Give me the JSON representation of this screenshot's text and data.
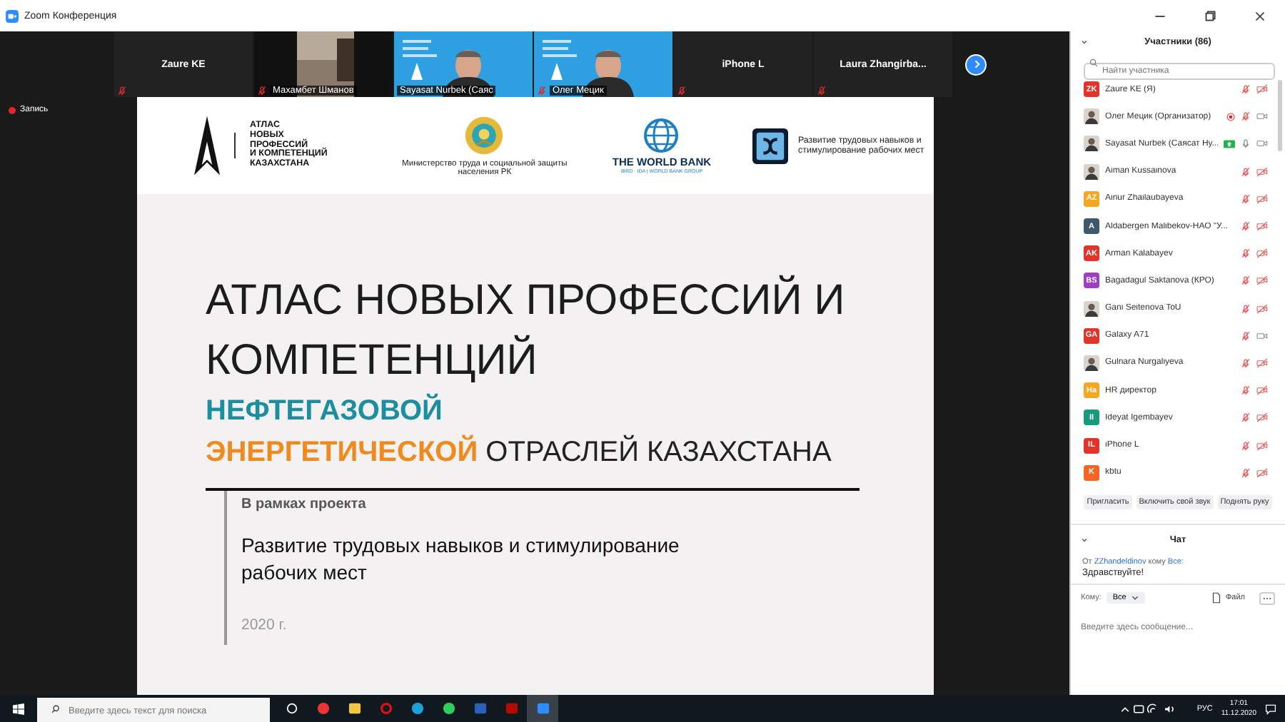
{
  "window": {
    "title": "Zoom Конференция"
  },
  "video_strip": {
    "tiles": [
      {
        "kind": "name",
        "name": "Zaure KE",
        "muted": true
      },
      {
        "kind": "video",
        "name": "Махамбет Шманов",
        "muted": true
      },
      {
        "kind": "video",
        "name": "Sayasat Nurbek (Саяс",
        "muted": false
      },
      {
        "kind": "video",
        "name": "Олег Мецик",
        "muted": true
      },
      {
        "kind": "name",
        "name": "iPhone L",
        "muted": true
      },
      {
        "kind": "name",
        "name": "Laura  Zhangirba...",
        "muted": true
      }
    ]
  },
  "recording": {
    "label": "Запись"
  },
  "slide": {
    "atlas_logo": [
      "АТЛАС",
      "НОВЫХ",
      "ПРОФЕССИЙ",
      "И КОМПЕТЕНЦИЙ",
      "КАЗАХСТАНА"
    ],
    "ministry": "Министерство труда и социальной защиты населения РК",
    "world_bank": "THE WORLD BANK",
    "world_bank_sub": "IBRD · IDA | WORLD BANK GROUP",
    "project_logo": "Развитие трудовых навыков и стимулирование рабочих мест",
    "title": "АТЛАС НОВЫХ ПРОФЕССИЙ И КОМПЕТЕНЦИЙ",
    "subtitle": [
      [
        {
          "text": "НЕФТЕГАЗОВОЙ",
          "color": "#1b8fa0",
          "bold": true
        }
      ],
      [
        {
          "text": "ЭНЕРГЕТИЧЕСКОЙ",
          "color": "#f08a1c",
          "bold": true
        },
        {
          "text": " ОТРАСЛЕЙ КАЗАХСТАНА",
          "color": "#222222",
          "bold": false
        }
      ]
    ],
    "project_label": "В рамках проекта",
    "project": "Развитие трудовых навыков и стимулирование рабочих мест",
    "year": "2020 г."
  },
  "participants": {
    "title": "Участники (86)",
    "search": {
      "placeholder": "Найти участника"
    },
    "items": [
      {
        "name": "Zaure KE (Я)",
        "avatar": {
          "kind": "initials",
          "initials": "ZK",
          "color": "#e0352b"
        },
        "recording": false,
        "sharing": false,
        "muted": true,
        "video_off": true
      },
      {
        "name": "Олег Мецик (Организатор)",
        "recording": true,
        "sharing": false,
        "muted": true,
        "video_off": false
      },
      {
        "name": "Sayasat Nurbek (Саясат Ну...",
        "recording": false,
        "sharing": true,
        "muted": false,
        "video_off": false
      },
      {
        "name": "Aiman Kussainova",
        "recording": false,
        "sharing": false,
        "muted": true,
        "video_off": true
      },
      {
        "name": "Ainur Zhailaubayeva",
        "avatar": {
          "kind": "initials",
          "initials": "AZ",
          "color": "#f5a623"
        },
        "recording": false,
        "sharing": false,
        "muted": true,
        "video_off": true
      },
      {
        "name": "Aldabergen Malibekov-НАО \"У...",
        "avatar": {
          "kind": "initials",
          "initials": "A",
          "color": "#3d5a6c"
        },
        "recording": false,
        "sharing": false,
        "muted": true,
        "video_off": true
      },
      {
        "name": "Arman Kalabayev",
        "avatar": {
          "kind": "initials",
          "initials": "AK",
          "color": "#e0352b"
        },
        "recording": false,
        "sharing": false,
        "muted": true,
        "video_off": true
      },
      {
        "name": "Bagadagul Saktanova (КРО)",
        "avatar": {
          "kind": "initials",
          "initials": "BS",
          "color": "#9c3fc1"
        },
        "recording": false,
        "sharing": false,
        "muted": true,
        "video_off": true
      },
      {
        "name": "Gani Seitenova ToU",
        "recording": false,
        "sharing": false,
        "muted": true,
        "video_off": true
      },
      {
        "name": "Galaxy A71",
        "avatar": {
          "kind": "initials",
          "initials": "GA",
          "color": "#e0352b"
        },
        "recording": false,
        "sharing": false,
        "muted": true,
        "video_off": false
      },
      {
        "name": "Gulnara Nurgaliyeva",
        "recording": false,
        "sharing": false,
        "muted": true,
        "video_off": true
      },
      {
        "name": "HR директор",
        "avatar": {
          "kind": "initials",
          "initials": "Ha",
          "color": "#f5a623"
        },
        "recording": false,
        "sharing": false,
        "muted": true,
        "video_off": true
      },
      {
        "name": "Ideyat Igembayev",
        "avatar": {
          "kind": "initials",
          "initials": "II",
          "color": "#1a9a7c"
        },
        "recording": false,
        "sharing": false,
        "muted": true,
        "video_off": true
      },
      {
        "name": "iPhone L",
        "avatar": {
          "kind": "initials",
          "initials": "IL",
          "color": "#e0352b"
        },
        "recording": false,
        "sharing": false,
        "muted": true,
        "video_off": true
      },
      {
        "name": "kbtu",
        "avatar": {
          "kind": "initials",
          "initials": "K",
          "color": "#f26522"
        },
        "recording": false,
        "sharing": false,
        "muted": true,
        "video_off": true
      }
    ],
    "buttons": [
      "Пригласить",
      "Включить свой звук",
      "Поднять руку"
    ]
  },
  "chat": {
    "title": "Чат",
    "messages": [
      {
        "from_label": "От",
        "from": "ZZhandeldinov",
        "to_label": "кому",
        "to": "Все:",
        "text": "Здравствуйте!"
      }
    ],
    "to_label": "Кому:",
    "recipient": "Все",
    "file": "Файл",
    "placeholder": "Введите здесь сообщение..."
  },
  "taskbar": {
    "search": {
      "placeholder": "Введите здесь текст для поиска"
    },
    "language": "РУС",
    "time": "17:01",
    "date": "11.12.2020"
  }
}
